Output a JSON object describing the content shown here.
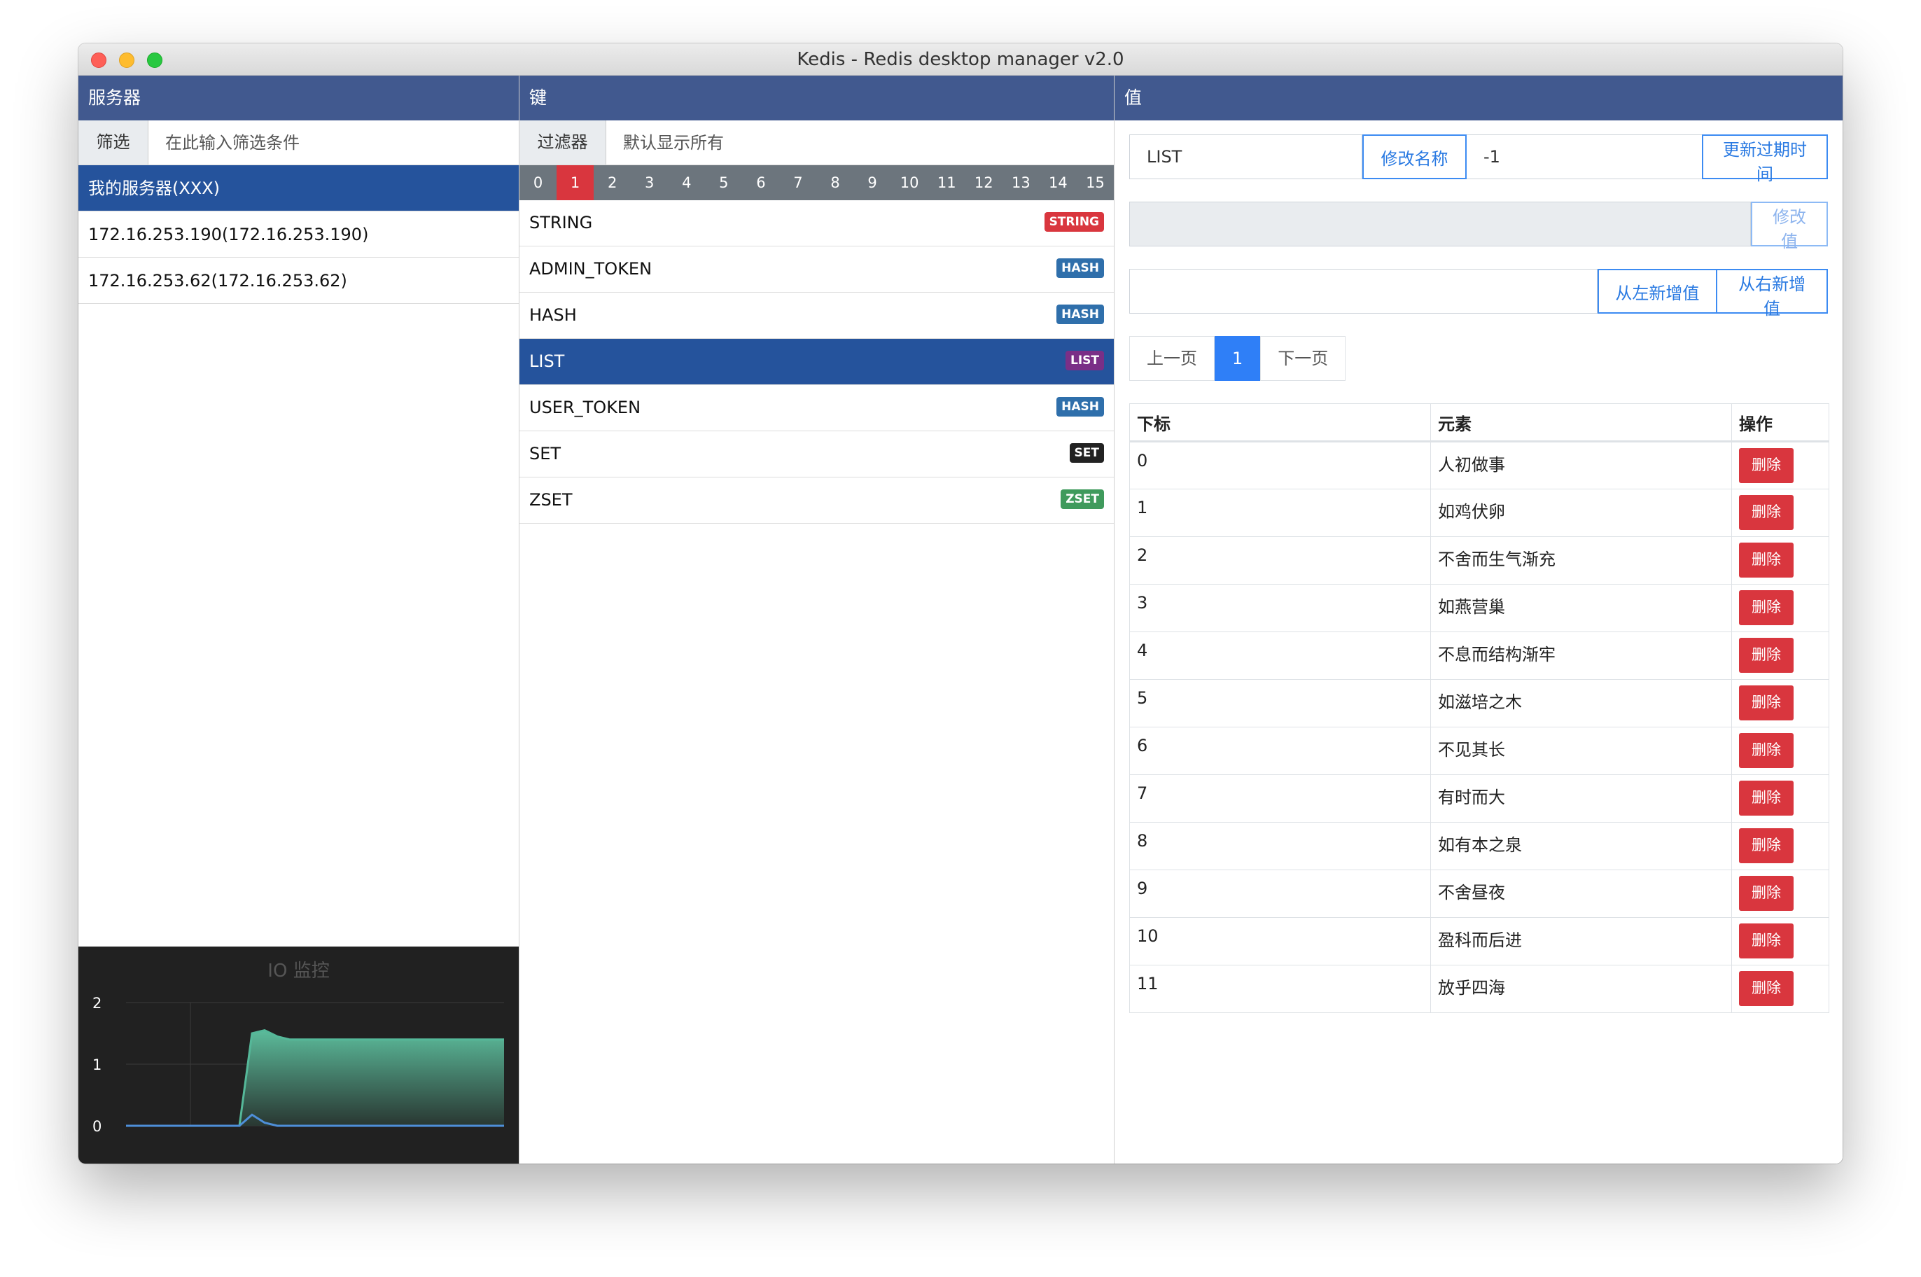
{
  "window": {
    "title": "Kedis - Redis desktop manager v2.0"
  },
  "servers": {
    "header": "服务器",
    "filter_label": "筛选",
    "filter_placeholder": "在此输入筛选条件",
    "items": [
      {
        "label": "我的服务器(XXX)",
        "active": true
      },
      {
        "label": "172.16.253.190(172.16.253.190)",
        "active": false
      },
      {
        "label": "172.16.253.62(172.16.253.62)",
        "active": false
      }
    ]
  },
  "io_monitor": {
    "title": "IO 监控",
    "y_ticks": [
      "2",
      "1",
      "0"
    ],
    "chart_data": {
      "type": "area",
      "title": "IO 监控",
      "ylim": [
        0,
        2
      ],
      "grid": true,
      "series": [
        {
          "values": [
            0,
            0,
            0,
            0,
            0,
            0,
            0,
            0,
            0,
            0,
            1.5,
            1.55,
            1.45,
            1.4,
            1.4,
            1.4,
            1.4,
            1.4,
            1.4,
            1.4,
            1.4,
            1.4,
            1.4,
            1.4,
            1.4,
            1.4,
            1.4,
            1.4,
            1.4,
            1.4,
            1.4
          ]
        },
        {
          "values": [
            0,
            0,
            0,
            0,
            0,
            0,
            0,
            0,
            0,
            0,
            0.18,
            0.05,
            0,
            0,
            0,
            0,
            0,
            0,
            0,
            0,
            0,
            0,
            0,
            0,
            0,
            0,
            0,
            0,
            0,
            0,
            0
          ]
        }
      ],
      "colors": [
        "#55b899",
        "#4e8fd9"
      ]
    }
  },
  "keys": {
    "header": "键",
    "filter_label": "过滤器",
    "filter_placeholder": "默认显示所有",
    "db_tabs": [
      "0",
      "1",
      "2",
      "3",
      "4",
      "5",
      "6",
      "7",
      "8",
      "9",
      "10",
      "11",
      "12",
      "13",
      "14",
      "15"
    ],
    "active_db": "1",
    "items": [
      {
        "name": "STRING",
        "type": "STRING",
        "badge_color": "#d9363e",
        "active": false
      },
      {
        "name": "ADMIN_TOKEN",
        "type": "HASH",
        "badge_color": "#2f6fab",
        "active": false
      },
      {
        "name": "HASH",
        "type": "HASH",
        "badge_color": "#2f6fab",
        "active": false
      },
      {
        "name": "LIST",
        "type": "LIST",
        "badge_color": "#7a2f87",
        "active": true
      },
      {
        "name": "USER_TOKEN",
        "type": "HASH",
        "badge_color": "#2f6fab",
        "active": false
      },
      {
        "name": "SET",
        "type": "SET",
        "badge_color": "#222222",
        "active": false
      },
      {
        "name": "ZSET",
        "type": "ZSET",
        "badge_color": "#3f9a5c",
        "active": false
      }
    ]
  },
  "value": {
    "header": "值",
    "key_name": "LIST",
    "rename_label": "修改名称",
    "ttl_value": "-1",
    "update_ttl_label": "更新过期时间",
    "value_text": "",
    "edit_value_label": "修改值",
    "new_value": "",
    "push_left_label": "从左新增值",
    "push_right_label": "从右新增值",
    "pagination": {
      "prev": "上一页",
      "current": "1",
      "next": "下一页"
    },
    "table": {
      "columns": [
        "下标",
        "元素",
        "操作"
      ],
      "delete_label": "删除",
      "rows": [
        {
          "index": "0",
          "element": "人初做事"
        },
        {
          "index": "1",
          "element": "如鸡伏卵"
        },
        {
          "index": "2",
          "element": "不舍而生气渐充"
        },
        {
          "index": "3",
          "element": "如燕营巢"
        },
        {
          "index": "4",
          "element": "不息而结构渐牢"
        },
        {
          "index": "5",
          "element": "如滋培之木"
        },
        {
          "index": "6",
          "element": "不见其长"
        },
        {
          "index": "7",
          "element": "有时而大"
        },
        {
          "index": "8",
          "element": "如有本之泉"
        },
        {
          "index": "9",
          "element": "不舍昼夜"
        },
        {
          "index": "10",
          "element": "盈科而后进"
        },
        {
          "index": "11",
          "element": "放乎四海"
        }
      ]
    }
  }
}
